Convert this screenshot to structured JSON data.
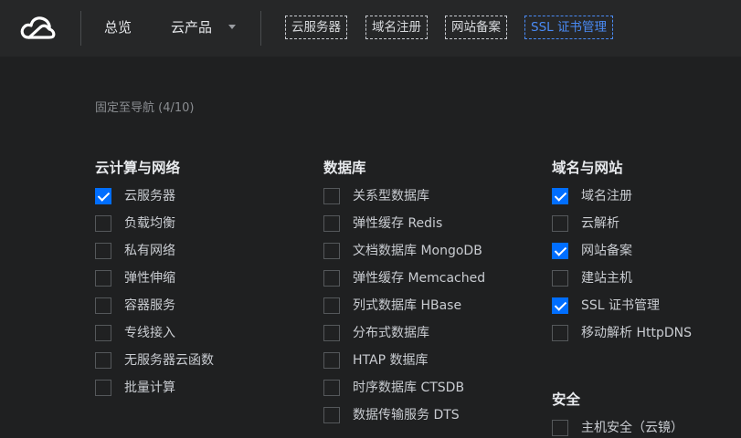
{
  "topbar": {
    "nav": [
      "总览",
      "云产品"
    ],
    "pinned": [
      {
        "label": "云服务器",
        "active": false
      },
      {
        "label": "域名注册",
        "active": false
      },
      {
        "label": "网站备案",
        "active": false
      },
      {
        "label": "SSL 证书管理",
        "active": true
      }
    ]
  },
  "panel": {
    "fixed_note": "固定至导航 (4/10)",
    "columns": [
      {
        "title": "云计算与网络",
        "items": [
          {
            "label": "云服务器",
            "checked": true
          },
          {
            "label": "负载均衡",
            "checked": false
          },
          {
            "label": "私有网络",
            "checked": false
          },
          {
            "label": "弹性伸缩",
            "checked": false
          },
          {
            "label": "容器服务",
            "checked": false
          },
          {
            "label": "专线接入",
            "checked": false
          },
          {
            "label": "无服务器云函数",
            "checked": false
          },
          {
            "label": "批量计算",
            "checked": false
          }
        ]
      },
      {
        "title": "数据库",
        "items": [
          {
            "label": "关系型数据库",
            "checked": false
          },
          {
            "label": "弹性缓存 Redis",
            "checked": false
          },
          {
            "label": "文档数据库 MongoDB",
            "checked": false
          },
          {
            "label": "弹性缓存 Memcached",
            "checked": false
          },
          {
            "label": "列式数据库 HBase",
            "checked": false
          },
          {
            "label": "分布式数据库",
            "checked": false
          },
          {
            "label": "HTAP 数据库",
            "checked": false
          },
          {
            "label": "时序数据库 CTSDB",
            "checked": false
          },
          {
            "label": "数据传输服务 DTS",
            "checked": false
          }
        ]
      },
      {
        "title": "域名与网站",
        "items": [
          {
            "label": "域名注册",
            "checked": true
          },
          {
            "label": "云解析",
            "checked": false
          },
          {
            "label": "网站备案",
            "checked": true
          },
          {
            "label": "建站主机",
            "checked": false
          },
          {
            "label": "SSL 证书管理",
            "checked": true
          },
          {
            "label": "移动解析 HttpDNS",
            "checked": false
          }
        ]
      },
      {
        "title": "安全",
        "items": [
          {
            "label": "主机安全（云镜）",
            "checked": false
          }
        ]
      }
    ]
  },
  "colors": {
    "accent": "#006eff",
    "link_active": "#4a8bf5",
    "bg": "#1f2021",
    "topbar_bg": "#262728"
  }
}
